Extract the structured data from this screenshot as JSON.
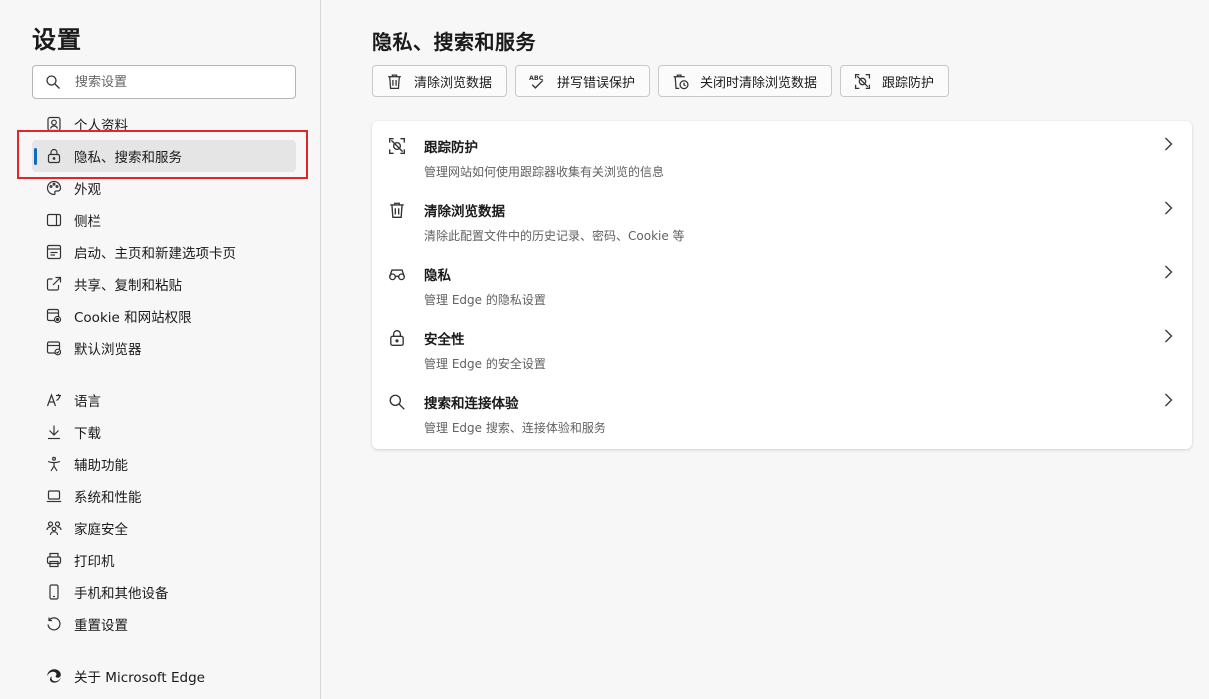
{
  "sidebar": {
    "title": "设置",
    "search_placeholder": "搜索设置",
    "items": [
      {
        "label": "个人资料"
      },
      {
        "label": "隐私、搜索和服务"
      },
      {
        "label": "外观"
      },
      {
        "label": "侧栏"
      },
      {
        "label": "启动、主页和新建选项卡页"
      },
      {
        "label": "共享、复制和粘贴"
      },
      {
        "label": "Cookie 和网站权限"
      },
      {
        "label": "默认浏览器"
      },
      {
        "label": "语言"
      },
      {
        "label": "下载"
      },
      {
        "label": "辅助功能"
      },
      {
        "label": "系统和性能"
      },
      {
        "label": "家庭安全"
      },
      {
        "label": "打印机"
      },
      {
        "label": "手机和其他设备"
      },
      {
        "label": "重置设置"
      },
      {
        "label": "关于 Microsoft Edge"
      }
    ],
    "active_index": 1
  },
  "main": {
    "title": "隐私、搜索和服务",
    "quick_actions": [
      {
        "label": "清除浏览数据",
        "icon": "trash-icon"
      },
      {
        "label": "拼写错误保护",
        "icon": "spellcheck-icon"
      },
      {
        "label": "关闭时清除浏览数据",
        "icon": "trash-clock-icon"
      },
      {
        "label": "跟踪防护",
        "icon": "tracking-icon"
      }
    ],
    "rows": [
      {
        "title": "跟踪防护",
        "desc": "管理网站如何使用跟踪器收集有关浏览的信息",
        "icon": "tracking-icon"
      },
      {
        "title": "清除浏览数据",
        "desc": "清除此配置文件中的历史记录、密码、Cookie 等",
        "icon": "trash-icon"
      },
      {
        "title": "隐私",
        "desc": "管理 Edge 的隐私设置",
        "icon": "glasses-icon"
      },
      {
        "title": "安全性",
        "desc": "管理 Edge 的安全设置",
        "icon": "lock-icon"
      },
      {
        "title": "搜索和连接体验",
        "desc": "管理 Edge 搜索、连接体验和服务",
        "icon": "search-icon"
      }
    ]
  },
  "colors": {
    "accent": "#0f6cbd",
    "highlight": "#e0262b",
    "active_bg": "#e5e5e5"
  }
}
